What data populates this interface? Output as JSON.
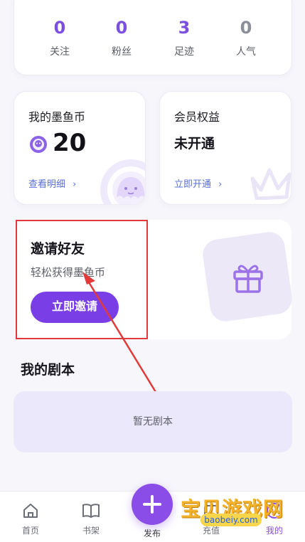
{
  "stats": [
    {
      "value": "0",
      "label": "关注"
    },
    {
      "value": "0",
      "label": "粉丝"
    },
    {
      "value": "3",
      "label": "足迹"
    },
    {
      "value": "0",
      "label": "人气"
    }
  ],
  "coin_card": {
    "title": "我的墨鱼币",
    "amount": "20",
    "link": "查看明细"
  },
  "vip_card": {
    "title": "会员权益",
    "status": "未开通",
    "link": "立即开通"
  },
  "invite": {
    "title": "邀请好友",
    "subtitle": "轻松获得墨鱼币",
    "button": "立即邀请"
  },
  "scripts_section": {
    "title": "我的剧本",
    "empty_text": "暂无剧本"
  },
  "tabs": [
    {
      "label": "首页",
      "icon": "home-icon"
    },
    {
      "label": "书架",
      "icon": "book-icon"
    },
    {
      "label": "发布",
      "icon": "plus-icon"
    },
    {
      "label": "充值",
      "icon": "wallet-icon"
    },
    {
      "label": "我的",
      "icon": "profile-icon"
    }
  ],
  "watermark": {
    "text": "宝贝游戏网",
    "url": "baobeiy.com"
  },
  "colors": {
    "accent": "#7a3ee6",
    "link": "#5a6fd8",
    "annotation": "#e23a3a",
    "empty_bg": "#ebe8fb"
  }
}
